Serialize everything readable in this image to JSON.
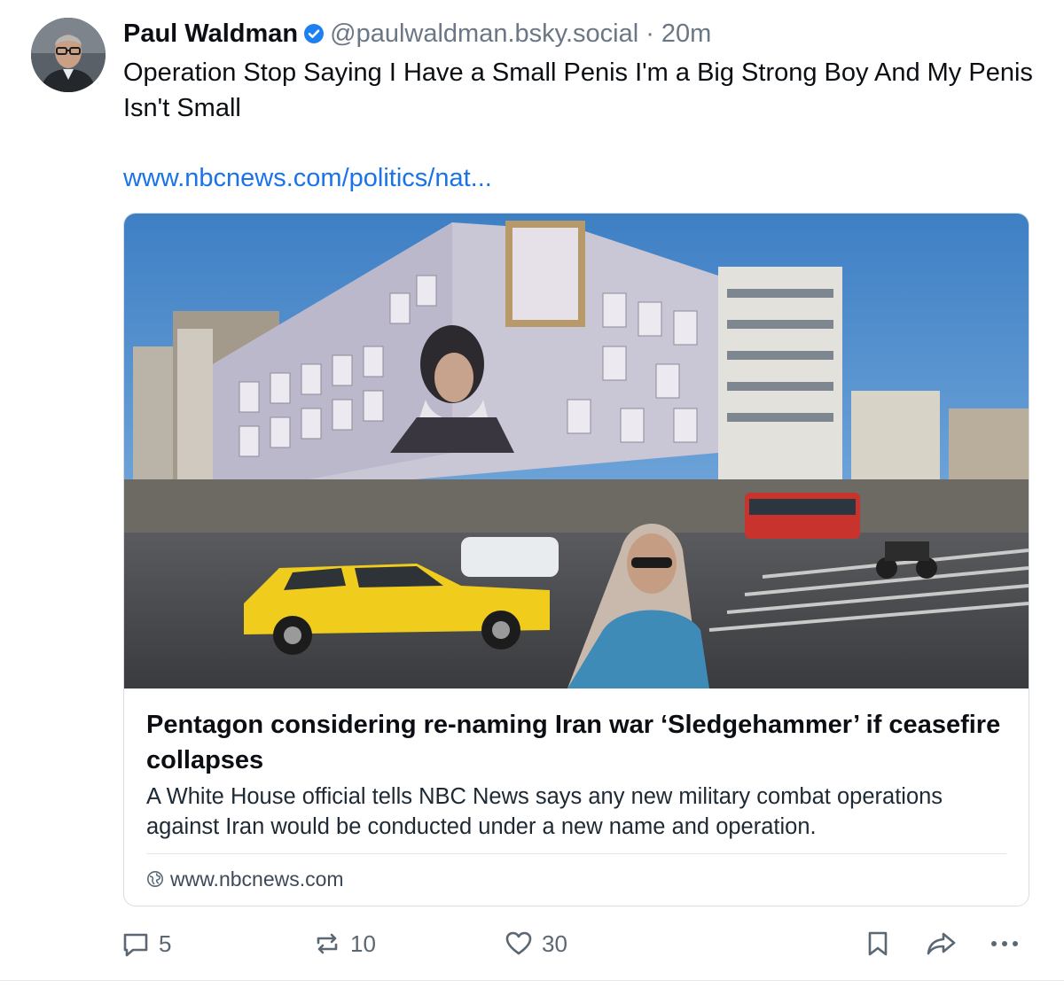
{
  "post": {
    "author": {
      "display_name": "Paul Waldman",
      "handle": "@paulwaldman.bsky.social",
      "verified": true
    },
    "separator": "·",
    "time_ago": "20m",
    "text": "Operation Stop Saying I Have a Small Penis I'm a Big Strong Boy And My Penis Isn't Small",
    "link_text": "www.nbcnews.com/politics/nat..."
  },
  "card": {
    "title": "Pentagon considering re-naming Iran war ‘Sledgehammer’ if ceasefire collapses",
    "description": "A White House official tells NBC News says any new military combat operations against Iran would be conducted under a new name and operation.",
    "domain": "www.nbcnews.com"
  },
  "actions": {
    "replies": "5",
    "reposts": "10",
    "likes": "30"
  },
  "icons": {
    "reply": "speech-bubble-icon",
    "repost": "repost-arrows-icon",
    "like": "heart-icon",
    "bookmark": "bookmark-icon",
    "share": "share-arrow-icon",
    "more": "ellipsis-icon",
    "verified": "verified-badge-icon",
    "domain": "globe-icon"
  },
  "colors": {
    "link": "#1a73e8",
    "verified": "#1d7ff0",
    "muted": "#6b7785",
    "border": "#d7dde3"
  }
}
